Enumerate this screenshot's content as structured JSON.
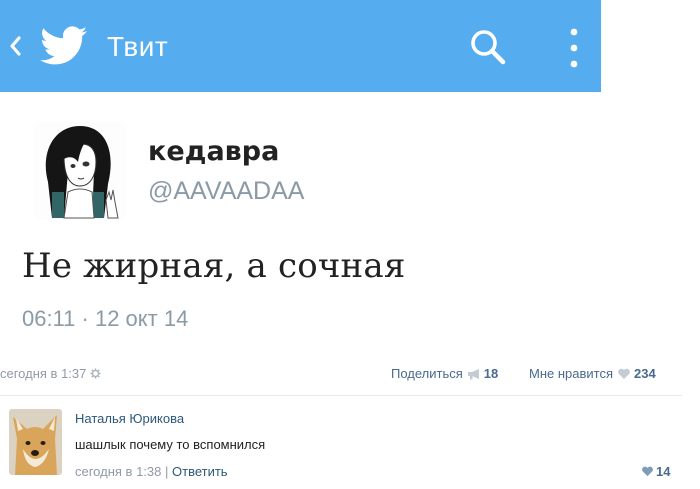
{
  "header": {
    "title": "Твит",
    "background": "#55acee"
  },
  "tweet": {
    "name": "кедавра",
    "handle": "@AAVAADAA",
    "text": "Не жирная, а сочная",
    "time": "06:11 · 12 окт 14"
  },
  "post": {
    "date": "сегодня в 1:37",
    "share_label": "Поделиться",
    "share_count": "18",
    "like_label": "Мне нравится",
    "like_count": "234"
  },
  "comment": {
    "author": "Наталья Юрикова",
    "text": "шашлык почему то вспомнился",
    "date": "сегодня в 1:38",
    "separator": "|",
    "reply_label": "Ответить",
    "like_count": "14"
  },
  "icons": {
    "back": "chevron-left-icon",
    "logo": "twitter-bird-icon",
    "search": "search-icon",
    "more": "more-vertical-icon",
    "settings": "gear-icon",
    "share": "megaphone-icon",
    "like": "heart-icon"
  }
}
